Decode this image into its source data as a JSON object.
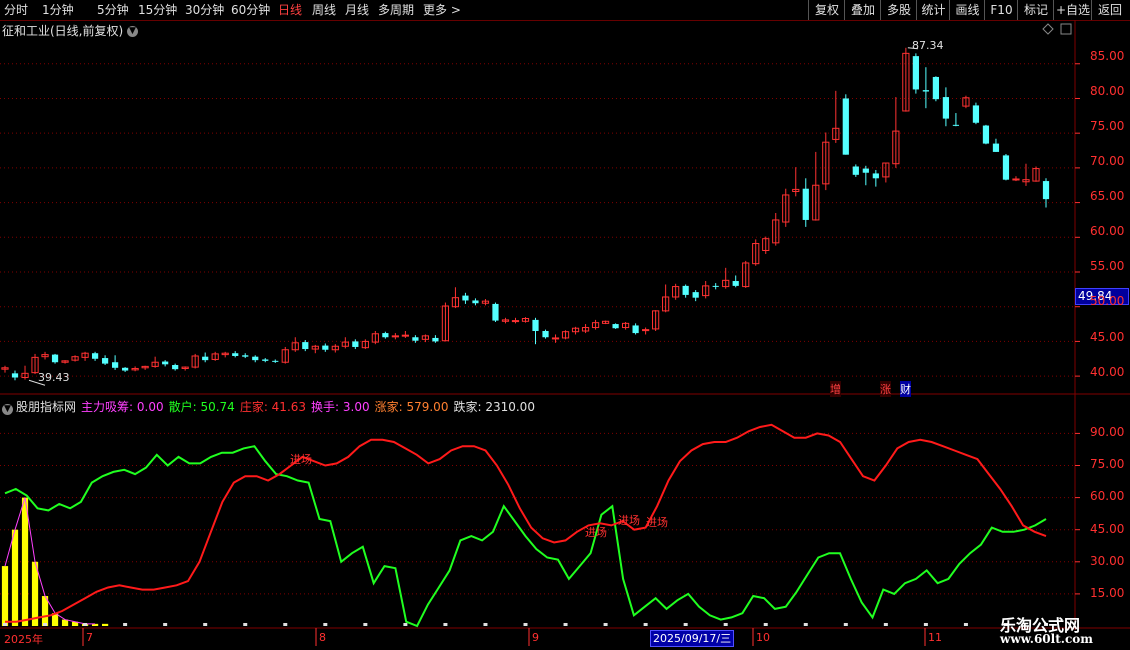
{
  "toolbar": {
    "periods": [
      "分时",
      "1分钟",
      "5分钟",
      "15分钟",
      "30分钟",
      "60分钟",
      "日线",
      "周线",
      "月线",
      "多周期",
      "更多 >"
    ],
    "active": "日线",
    "right": [
      "复权",
      "叠加",
      "多股",
      "统计",
      "画线",
      "F10",
      "标记",
      "+自选",
      "返回"
    ]
  },
  "stock": {
    "title": "征和工业(日线,前复权)",
    "current_price_box": "49.84",
    "high_label": "87.34",
    "low_label": "39.43",
    "marks": [
      "增",
      "涨",
      "财"
    ]
  },
  "indicator": {
    "name": "股朋指标网",
    "items": [
      {
        "text": "主力吸筹: 0.00",
        "color": "#ff40ff"
      },
      {
        "text": "散户: 50.74",
        "color": "#20ff20"
      },
      {
        "text": "庄家: 41.63",
        "color": "#ff3030"
      },
      {
        "text": "换手: 3.00",
        "color": "#ff40ff"
      },
      {
        "text": "涨家: 579.00",
        "color": "#ff8030"
      },
      {
        "text": "跌家: 2310.00",
        "color": "#e0e0e0"
      }
    ],
    "annotations": [
      "进场",
      "进场",
      "进场",
      "进场"
    ]
  },
  "axis": {
    "price_ticks": [
      "85.00",
      "80.00",
      "75.00",
      "70.00",
      "65.00",
      "60.00",
      "55.00",
      "50.00",
      "45.00",
      "40.00"
    ],
    "ind_ticks": [
      "90.00",
      "75.00",
      "60.00",
      "45.00",
      "30.00",
      "15.00"
    ],
    "dates": [
      "2025年",
      "7",
      "8",
      "9",
      "10",
      "11"
    ],
    "date_cursor": "2025/09/17/三"
  },
  "watermark": {
    "line1": "乐淘公式网",
    "line2": "www.60lt.com"
  },
  "colors": {
    "up": "#ff3232",
    "down": "#54ffff",
    "green_line": "#20ff20",
    "red_line": "#ff1a1a",
    "yellow_bar": "#ffff00",
    "grid": "#800000"
  },
  "chart_data": {
    "type": "candlestick",
    "ylim": [
      38,
      89
    ],
    "candles": [
      {
        "o": 41,
        "h": 41.5,
        "l": 40.5,
        "c": 41.2
      },
      {
        "o": 40.4,
        "h": 40.8,
        "l": 39.4,
        "c": 39.8
      },
      {
        "o": 39.8,
        "h": 41.5,
        "l": 39.5,
        "c": 40.4
      },
      {
        "o": 40.5,
        "h": 43.2,
        "l": 40.3,
        "c": 42.7
      },
      {
        "o": 42.8,
        "h": 43.5,
        "l": 42.4,
        "c": 43.1
      },
      {
        "o": 43.1,
        "h": 43.2,
        "l": 41.8,
        "c": 42.0
      },
      {
        "o": 42.0,
        "h": 42.3,
        "l": 41.8,
        "c": 42.2
      },
      {
        "o": 42.3,
        "h": 43.0,
        "l": 42.1,
        "c": 42.8
      },
      {
        "o": 42.7,
        "h": 43.5,
        "l": 42.2,
        "c": 43.3
      },
      {
        "o": 43.3,
        "h": 43.5,
        "l": 42.2,
        "c": 42.5
      },
      {
        "o": 42.6,
        "h": 43.0,
        "l": 41.6,
        "c": 41.8
      },
      {
        "o": 42.0,
        "h": 43.0,
        "l": 40.9,
        "c": 41.2
      },
      {
        "o": 41.2,
        "h": 41.3,
        "l": 40.6,
        "c": 40.8
      },
      {
        "o": 40.9,
        "h": 41.4,
        "l": 40.7,
        "c": 41.1
      },
      {
        "o": 41.2,
        "h": 41.5,
        "l": 40.9,
        "c": 41.4
      },
      {
        "o": 41.4,
        "h": 42.8,
        "l": 41.2,
        "c": 42.0
      },
      {
        "o": 42.1,
        "h": 42.3,
        "l": 41.4,
        "c": 41.7
      },
      {
        "o": 41.6,
        "h": 41.8,
        "l": 40.8,
        "c": 41.0
      },
      {
        "o": 41.1,
        "h": 41.4,
        "l": 40.8,
        "c": 41.3
      },
      {
        "o": 41.3,
        "h": 43.2,
        "l": 41.1,
        "c": 42.9
      },
      {
        "o": 42.8,
        "h": 43.4,
        "l": 42.0,
        "c": 42.3
      },
      {
        "o": 42.4,
        "h": 43.5,
        "l": 42.2,
        "c": 43.2
      },
      {
        "o": 43.1,
        "h": 43.5,
        "l": 42.7,
        "c": 43.3
      },
      {
        "o": 43.3,
        "h": 43.6,
        "l": 42.7,
        "c": 42.9
      },
      {
        "o": 43.0,
        "h": 43.3,
        "l": 42.6,
        "c": 42.8
      },
      {
        "o": 42.8,
        "h": 43.0,
        "l": 42.0,
        "c": 42.3
      },
      {
        "o": 42.4,
        "h": 42.6,
        "l": 42.0,
        "c": 42.2
      },
      {
        "o": 42.2,
        "h": 42.4,
        "l": 41.9,
        "c": 42.1
      },
      {
        "o": 42.0,
        "h": 44.2,
        "l": 41.8,
        "c": 43.8
      },
      {
        "o": 43.8,
        "h": 45.6,
        "l": 43.5,
        "c": 44.8
      },
      {
        "o": 44.9,
        "h": 45.2,
        "l": 43.6,
        "c": 43.9
      },
      {
        "o": 43.9,
        "h": 44.5,
        "l": 43.3,
        "c": 44.3
      },
      {
        "o": 44.4,
        "h": 44.7,
        "l": 43.5,
        "c": 43.8
      },
      {
        "o": 43.8,
        "h": 44.6,
        "l": 43.4,
        "c": 44.3
      },
      {
        "o": 44.3,
        "h": 45.6,
        "l": 44.0,
        "c": 44.9
      },
      {
        "o": 45.0,
        "h": 45.3,
        "l": 43.9,
        "c": 44.2
      },
      {
        "o": 44.1,
        "h": 45.3,
        "l": 43.9,
        "c": 45.0
      },
      {
        "o": 44.9,
        "h": 46.5,
        "l": 44.6,
        "c": 46.1
      },
      {
        "o": 46.2,
        "h": 46.4,
        "l": 45.4,
        "c": 45.6
      },
      {
        "o": 45.7,
        "h": 46.2,
        "l": 45.3,
        "c": 45.8
      },
      {
        "o": 45.8,
        "h": 46.5,
        "l": 45.5,
        "c": 45.9
      },
      {
        "o": 45.6,
        "h": 45.9,
        "l": 44.8,
        "c": 45.1
      },
      {
        "o": 45.3,
        "h": 46.0,
        "l": 44.9,
        "c": 45.8
      },
      {
        "o": 45.5,
        "h": 45.9,
        "l": 44.8,
        "c": 45.0
      },
      {
        "o": 45.1,
        "h": 50.6,
        "l": 45.0,
        "c": 50.1
      },
      {
        "o": 50.0,
        "h": 52.8,
        "l": 49.8,
        "c": 51.3
      },
      {
        "o": 51.6,
        "h": 52.0,
        "l": 50.4,
        "c": 50.9
      },
      {
        "o": 50.9,
        "h": 51.2,
        "l": 50.2,
        "c": 50.5
      },
      {
        "o": 50.5,
        "h": 51.1,
        "l": 50.2,
        "c": 50.8
      },
      {
        "o": 50.4,
        "h": 50.6,
        "l": 47.8,
        "c": 48.0
      },
      {
        "o": 47.9,
        "h": 48.4,
        "l": 47.6,
        "c": 48.1
      },
      {
        "o": 48.0,
        "h": 48.4,
        "l": 47.6,
        "c": 48.0
      },
      {
        "o": 47.9,
        "h": 48.5,
        "l": 47.7,
        "c": 48.3
      },
      {
        "o": 48.1,
        "h": 48.4,
        "l": 44.6,
        "c": 46.5
      },
      {
        "o": 46.5,
        "h": 46.7,
        "l": 45.4,
        "c": 45.6
      },
      {
        "o": 45.4,
        "h": 46.0,
        "l": 44.8,
        "c": 45.5
      },
      {
        "o": 45.5,
        "h": 46.6,
        "l": 45.3,
        "c": 46.4
      },
      {
        "o": 46.4,
        "h": 47.1,
        "l": 46.0,
        "c": 46.9
      },
      {
        "o": 46.5,
        "h": 47.5,
        "l": 46.2,
        "c": 47.0
      },
      {
        "o": 47.0,
        "h": 48.1,
        "l": 46.7,
        "c": 47.7
      },
      {
        "o": 47.6,
        "h": 48.0,
        "l": 47.5,
        "c": 47.9
      },
      {
        "o": 47.5,
        "h": 47.6,
        "l": 46.8,
        "c": 46.9
      },
      {
        "o": 47.0,
        "h": 47.8,
        "l": 46.7,
        "c": 47.6
      },
      {
        "o": 47.3,
        "h": 47.6,
        "l": 46.0,
        "c": 46.2
      },
      {
        "o": 46.6,
        "h": 47.0,
        "l": 46.0,
        "c": 46.7
      },
      {
        "o": 46.8,
        "h": 49.5,
        "l": 46.5,
        "c": 49.4
      },
      {
        "o": 49.4,
        "h": 53.2,
        "l": 49.2,
        "c": 51.4
      },
      {
        "o": 51.4,
        "h": 53.3,
        "l": 51.0,
        "c": 52.9
      },
      {
        "o": 53.0,
        "h": 53.2,
        "l": 51.3,
        "c": 51.7
      },
      {
        "o": 52.1,
        "h": 52.4,
        "l": 50.8,
        "c": 51.3
      },
      {
        "o": 51.6,
        "h": 53.7,
        "l": 51.2,
        "c": 53.0
      },
      {
        "o": 53.0,
        "h": 53.4,
        "l": 52.5,
        "c": 52.9
      },
      {
        "o": 52.9,
        "h": 55.6,
        "l": 52.6,
        "c": 53.8
      },
      {
        "o": 53.7,
        "h": 54.5,
        "l": 52.8,
        "c": 53.0
      },
      {
        "o": 52.9,
        "h": 56.6,
        "l": 52.7,
        "c": 56.3
      },
      {
        "o": 56.2,
        "h": 59.7,
        "l": 55.9,
        "c": 59.1
      },
      {
        "o": 58.1,
        "h": 60.1,
        "l": 57.6,
        "c": 59.8
      },
      {
        "o": 59.2,
        "h": 63.5,
        "l": 58.8,
        "c": 62.5
      },
      {
        "o": 62.2,
        "h": 67.0,
        "l": 61.5,
        "c": 66.1
      },
      {
        "o": 66.6,
        "h": 70.1,
        "l": 65.9,
        "c": 66.9
      },
      {
        "o": 67.0,
        "h": 68.5,
        "l": 61.5,
        "c": 62.5
      },
      {
        "o": 62.5,
        "h": 72.3,
        "l": 62.4,
        "c": 67.5
      },
      {
        "o": 67.7,
        "h": 75.1,
        "l": 66.8,
        "c": 73.7
      },
      {
        "o": 74.1,
        "h": 81.1,
        "l": 73.6,
        "c": 75.7
      },
      {
        "o": 80.0,
        "h": 80.6,
        "l": 71.9,
        "c": 71.9
      },
      {
        "o": 70.2,
        "h": 70.5,
        "l": 68.7,
        "c": 69.0
      },
      {
        "o": 69.9,
        "h": 70.3,
        "l": 67.5,
        "c": 69.3
      },
      {
        "o": 69.2,
        "h": 69.7,
        "l": 67.3,
        "c": 68.5
      },
      {
        "o": 68.7,
        "h": 70.7,
        "l": 67.9,
        "c": 70.7
      },
      {
        "o": 70.6,
        "h": 80.2,
        "l": 70.0,
        "c": 75.3
      },
      {
        "o": 78.2,
        "h": 87.3,
        "l": 78.1,
        "c": 86.5
      },
      {
        "o": 86.1,
        "h": 86.5,
        "l": 80.7,
        "c": 81.3
      },
      {
        "o": 81.2,
        "h": 84.5,
        "l": 78.6,
        "c": 81.0
      },
      {
        "o": 83.1,
        "h": 83.2,
        "l": 79.6,
        "c": 79.9
      },
      {
        "o": 80.2,
        "h": 81.6,
        "l": 76.0,
        "c": 77.1
      },
      {
        "o": 76.2,
        "h": 77.9,
        "l": 76.0,
        "c": 76.1
      },
      {
        "o": 78.9,
        "h": 80.4,
        "l": 78.6,
        "c": 80.1
      },
      {
        "o": 79.0,
        "h": 79.4,
        "l": 76.3,
        "c": 76.5
      },
      {
        "o": 76.1,
        "h": 76.2,
        "l": 73.4,
        "c": 73.5
      },
      {
        "o": 73.5,
        "h": 74.2,
        "l": 72.3,
        "c": 72.3
      },
      {
        "o": 71.8,
        "h": 72.0,
        "l": 68.2,
        "c": 68.3
      },
      {
        "o": 68.3,
        "h": 68.8,
        "l": 68.1,
        "c": 68.4
      },
      {
        "o": 68.0,
        "h": 70.6,
        "l": 67.4,
        "c": 68.3
      },
      {
        "o": 68.1,
        "h": 70.2,
        "l": 68.0,
        "c": 69.9
      },
      {
        "o": 68.1,
        "h": 68.5,
        "l": 64.3,
        "c": 65.5
      }
    ],
    "ind_ylim": [
      0,
      100
    ],
    "green_line": [
      62,
      64,
      61,
      55,
      54,
      57,
      55,
      58,
      67,
      70,
      72,
      73,
      71,
      74,
      80,
      75,
      79,
      76,
      76,
      79,
      81,
      81,
      83,
      84,
      77,
      71,
      70,
      68,
      67,
      50,
      49,
      30,
      34,
      37,
      20,
      28,
      27,
      2,
      0,
      10,
      18,
      26,
      40,
      42,
      40,
      44,
      56,
      49,
      42,
      36,
      32,
      31,
      22,
      28,
      34,
      52,
      56,
      22,
      5,
      9,
      13,
      8,
      12,
      15,
      9,
      5,
      3,
      4,
      6,
      14,
      13,
      8,
      9,
      16,
      24,
      32,
      34,
      34,
      22,
      11,
      4,
      17,
      15,
      20,
      22,
      26,
      20,
      22,
      29,
      34,
      38,
      46,
      44,
      44,
      45,
      47,
      50
    ],
    "red_line": [
      2,
      2,
      3,
      4,
      5,
      7,
      10,
      13,
      16,
      18,
      19,
      18,
      17,
      17,
      18,
      19,
      21,
      30,
      44,
      58,
      67,
      70,
      70,
      68,
      71,
      75,
      79,
      77,
      75,
      76,
      79,
      84,
      87,
      87,
      86,
      83,
      80,
      76,
      78,
      82,
      84,
      84,
      82,
      75,
      66,
      55,
      46,
      41,
      39,
      40,
      44,
      47,
      48,
      47,
      49,
      45,
      46,
      56,
      68,
      77,
      82,
      85,
      86,
      86,
      88,
      91,
      93,
      94,
      91,
      88,
      88,
      90,
      89,
      86,
      78,
      70,
      68,
      75,
      83,
      86,
      87,
      86,
      84,
      82,
      80,
      78,
      71,
      64,
      56,
      47,
      44,
      42
    ],
    "yellow_bars": [
      28,
      45,
      60,
      30,
      14,
      6,
      3,
      2,
      1,
      1,
      1,
      0,
      0,
      0,
      0,
      0,
      0,
      0,
      0,
      0,
      0,
      0,
      0,
      0,
      0,
      0,
      0,
      0,
      0,
      0,
      0,
      0,
      0,
      0,
      0,
      0,
      0,
      0,
      0,
      0,
      0,
      0,
      0,
      0,
      0,
      0,
      0,
      0,
      0,
      0,
      0,
      0,
      0,
      0,
      0,
      0,
      0,
      0,
      0,
      0,
      0,
      0,
      0,
      0,
      0,
      0,
      0,
      0,
      0,
      0,
      0,
      0,
      0,
      0,
      0,
      0,
      0,
      0,
      0,
      0,
      0,
      0,
      0,
      0,
      0,
      0,
      0,
      0,
      0,
      0,
      0,
      0,
      0,
      0,
      0,
      0,
      0,
      0,
      0,
      0,
      0,
      0,
      0,
      0,
      0,
      0,
      0
    ]
  }
}
